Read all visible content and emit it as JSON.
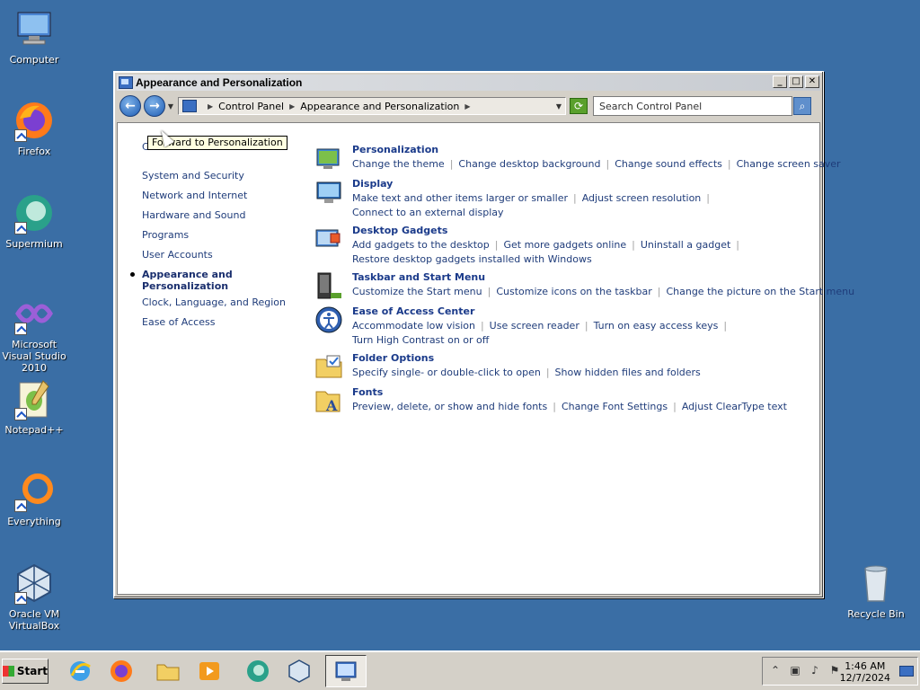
{
  "desktop": {
    "icons": [
      {
        "label": "Computer"
      },
      {
        "label": "Firefox"
      },
      {
        "label": "Supermium"
      },
      {
        "label": "Microsoft Visual Studio 2010"
      },
      {
        "label": "Notepad++"
      },
      {
        "label": "Everything"
      },
      {
        "label": "Oracle VM VirtualBox"
      },
      {
        "label": "Recycle Bin"
      }
    ]
  },
  "window": {
    "title": "Appearance and Personalization",
    "controls": {
      "minimize": "_",
      "maximize": "□",
      "close": "✕"
    },
    "address": {
      "crumbs": [
        "Control Panel",
        "Appearance and Personalization"
      ],
      "search_placeholder": "Search Control Panel"
    },
    "leftnav": {
      "items": [
        "Control Panel Home",
        "System and Security",
        "Network and Internet",
        "Hardware and Sound",
        "Programs",
        "User Accounts",
        "Appearance and Personalization",
        "Clock, Language, and Region",
        "Ease of Access"
      ]
    },
    "tooltip": "Forward to Personalization",
    "categories": [
      {
        "title": "Personalization",
        "links": [
          "Change the theme",
          "Change desktop background",
          "Change sound effects",
          "Change screen saver"
        ]
      },
      {
        "title": "Display",
        "links": [
          "Make text and other items larger or smaller",
          "Adjust screen resolution",
          "Connect to an external display"
        ]
      },
      {
        "title": "Desktop Gadgets",
        "links": [
          "Add gadgets to the desktop",
          "Get more gadgets online",
          "Uninstall a gadget",
          "Restore desktop gadgets installed with Windows"
        ]
      },
      {
        "title": "Taskbar and Start Menu",
        "links": [
          "Customize the Start menu",
          "Customize icons on the taskbar",
          "Change the picture on the Start menu"
        ]
      },
      {
        "title": "Ease of Access Center",
        "links": [
          "Accommodate low vision",
          "Use screen reader",
          "Turn on easy access keys",
          "Turn High Contrast on or off"
        ]
      },
      {
        "title": "Folder Options",
        "links": [
          "Specify single- or double-click to open",
          "Show hidden files and folders"
        ]
      },
      {
        "title": "Fonts",
        "links": [
          "Preview, delete, or show and hide fonts",
          "Change Font Settings",
          "Adjust ClearType text"
        ]
      }
    ]
  },
  "taskbar": {
    "start_label": "Start",
    "clock_time": "1:46 AM",
    "clock_date": "12/7/2024"
  },
  "colors": {
    "desktop": "#3a6ea5",
    "link": "#1f3c7a",
    "category_title": "#1a3a8a"
  }
}
